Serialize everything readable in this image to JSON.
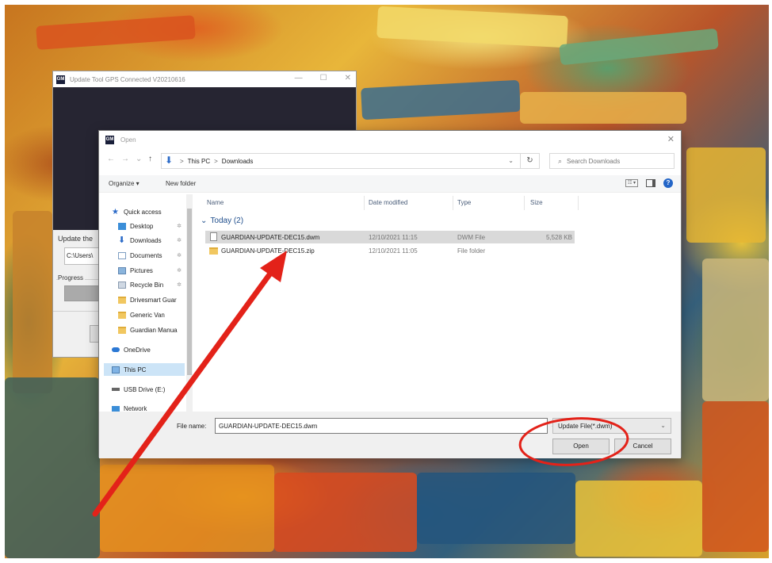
{
  "tool_window": {
    "title": "Update Tool   GPS Connected   V20210616",
    "icon_text": "GM",
    "controls": [
      "—",
      "☐",
      "✕"
    ],
    "update_label": "Update the",
    "path_value": "C:\\Users\\",
    "progress_label": "Progress"
  },
  "dialog": {
    "title": "Open",
    "icon_text": "GM",
    "close": "✕",
    "nav": {
      "back": "←",
      "forward": "→",
      "recent": "⌄",
      "up": "↑"
    },
    "breadcrumb": [
      "This PC",
      "Downloads"
    ],
    "breadcrumb_sep": ">",
    "address_drop": "⌄",
    "refresh": "↻",
    "search_placeholder": "Search Downloads",
    "search_glyph": "⌕",
    "toolbar": {
      "organize": "Organize ▾",
      "new_folder": "New folder",
      "view": "☷ ▾",
      "help": "?"
    }
  },
  "nav_pane": {
    "items": [
      {
        "label": "Quick access",
        "icon": "star-icon"
      },
      {
        "label": "Desktop",
        "icon": "desktop-icon",
        "pinned": true
      },
      {
        "label": "Downloads",
        "icon": "download-icon",
        "pinned": true
      },
      {
        "label": "Documents",
        "icon": "document-icon",
        "pinned": true
      },
      {
        "label": "Pictures",
        "icon": "picture-icon",
        "pinned": true
      },
      {
        "label": "Recycle Bin",
        "icon": "recycle-bin-icon",
        "pinned": true
      },
      {
        "label": "Drivesmart Guar",
        "icon": "folder-icon"
      },
      {
        "label": "Generic Van",
        "icon": "folder-icon"
      },
      {
        "label": "Guardian Manua",
        "icon": "folder-icon"
      },
      {
        "label": "OneDrive",
        "icon": "cloud-icon"
      },
      {
        "label": "This PC",
        "icon": "computer-icon",
        "selected": true
      },
      {
        "label": "USB Drive (E:)",
        "icon": "usb-drive-icon"
      },
      {
        "label": "Network",
        "icon": "network-icon"
      }
    ],
    "pin_glyph": "✲",
    "star_glyph": "★",
    "down_glyph": "⬇"
  },
  "file_list": {
    "columns": [
      "Name",
      "Date modified",
      "Type",
      "Size"
    ],
    "group": {
      "chevron": "⌄",
      "label": "Today (2)"
    },
    "rows": [
      {
        "name": "GUARDIAN-UPDATE-DEC15.dwm",
        "date": "12/10/2021 11:15",
        "type": "DWM File",
        "size": "5,528 KB",
        "selected": true
      },
      {
        "name": "GUARDIAN-UPDATE-DEC15.zip",
        "date": "12/10/2021 11:05",
        "type": "File folder",
        "size": ""
      }
    ]
  },
  "bottom": {
    "file_name_label": "File name:",
    "file_name_value": "GUARDIAN-UPDATE-DEC15.dwm",
    "file_name_drop": "⌄",
    "file_type": "Update File(*.dwm)",
    "file_type_caret": "⌄",
    "open_button": "Open",
    "cancel_button": "Cancel"
  },
  "annotation_color": "#e32219"
}
